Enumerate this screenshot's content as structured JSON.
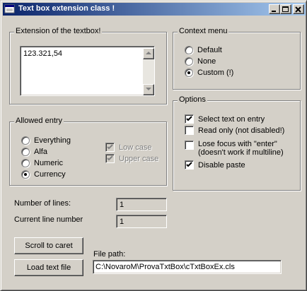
{
  "window": {
    "title": "Text box extension class !"
  },
  "textbox_group": {
    "legend": "Extension of the textbox!",
    "value": "123.321,54"
  },
  "context_menu": {
    "legend": "Context menu",
    "options": [
      {
        "label": "Default",
        "selected": false
      },
      {
        "label": "None",
        "selected": false
      },
      {
        "label": "Custom (!)",
        "selected": true
      }
    ]
  },
  "allowed_entry": {
    "legend": "Allowed entry",
    "options": [
      {
        "label": "Everything",
        "selected": false
      },
      {
        "label": "Alfa",
        "selected": false
      },
      {
        "label": "Numeric",
        "selected": false
      },
      {
        "label": "Currency",
        "selected": true
      }
    ],
    "checks": [
      {
        "label": "Low case",
        "checked": true,
        "enabled": false
      },
      {
        "label": "Upper case",
        "checked": true,
        "enabled": false
      }
    ]
  },
  "options": {
    "legend": "Options",
    "checks": [
      {
        "label": "Select text on entry",
        "checked": true
      },
      {
        "label": "Read only (not disabled!)",
        "checked": false
      },
      {
        "label": "Lose focus with \"enter\"",
        "label2": "(doesn't work if multiline)",
        "checked": false
      },
      {
        "label": "Disable paste",
        "checked": true
      }
    ]
  },
  "stats": {
    "lines_label": "Number of lines:",
    "lines_value": "1",
    "current_label": "Current line number",
    "current_value": "1"
  },
  "buttons": {
    "scroll": "Scroll to caret",
    "load": "Load text file"
  },
  "file": {
    "label": "File path:",
    "value": "C:\\NovaroM\\ProvaTxtBox\\cTxtBoxEx.cls"
  }
}
